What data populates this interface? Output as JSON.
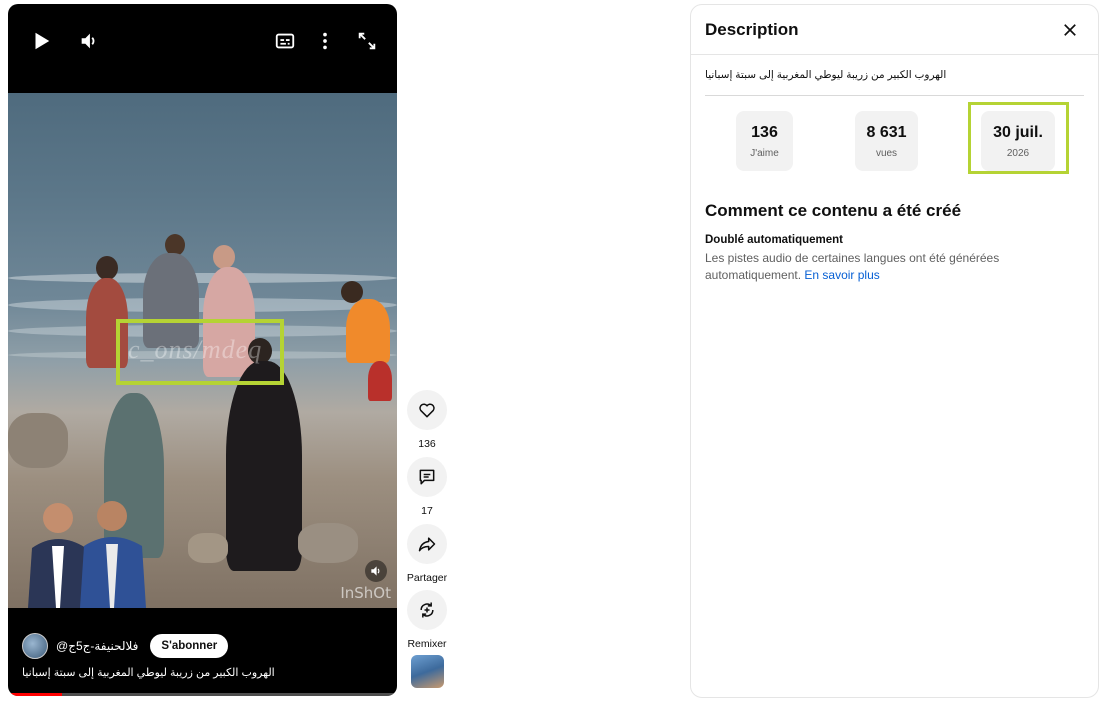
{
  "player": {
    "icons": {
      "play": "play-icon",
      "volume": "volume-icon",
      "captions": "captions-icon",
      "more": "more-vert-icon",
      "fullscreen": "fullscreen-icon"
    },
    "overlay_text": "InShOt",
    "watermark_text": "c_ons/mdeq",
    "channel_name": "@فلالحنيفة-ج5ج",
    "subscribe_label": "S'abonner",
    "video_title": "الهروب الكبير من زريبة ليوطي المغربية إلى سبتة إسبانيا",
    "progress": 0.14
  },
  "actions": {
    "like_count": "136",
    "comment_count": "17",
    "share_label": "Partager",
    "remix_label": "Remixer"
  },
  "panel": {
    "title": "Description",
    "description": "الهروب الكبير من زريبة ليوطي المغربية إلى سبتة إسبانيا",
    "stats": [
      {
        "value": "136",
        "label": "J'aime"
      },
      {
        "value": "8 631",
        "label": "vues"
      },
      {
        "value": "30 juil.",
        "label": "2026"
      }
    ],
    "how_title": "Comment ce contenu a été créé",
    "how_subtitle": "Doublé automatiquement",
    "how_text": "Les pistes audio de certaines langues ont été générées automatiquement. ",
    "learn_more": "En savoir plus"
  },
  "colors": {
    "highlight": "#b5d334",
    "link": "#065fd4",
    "progress": "#ff0000"
  }
}
